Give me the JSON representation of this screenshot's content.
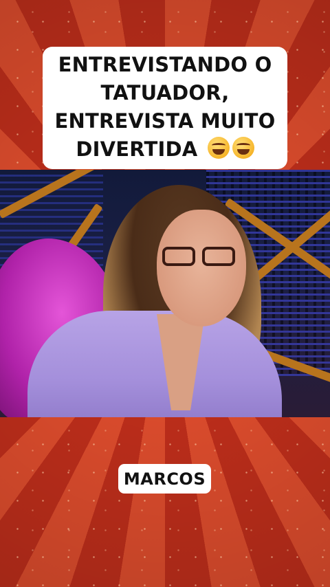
{
  "title": {
    "lines": [
      "ENTREVISTANDO O",
      "TATUADOR,",
      "ENTREVISTA MUITO",
      "DIVERTIDA"
    ],
    "emoji_icon": "grinning-sweat-emoji",
    "emoji_count": 2
  },
  "video": {
    "scene": "interview-clip"
  },
  "caption": {
    "label": "MARCOS"
  },
  "colors": {
    "ray_light": "#e8502f",
    "ray_dark": "#c7301c",
    "box_bg": "#ffffff",
    "text": "#111111"
  }
}
